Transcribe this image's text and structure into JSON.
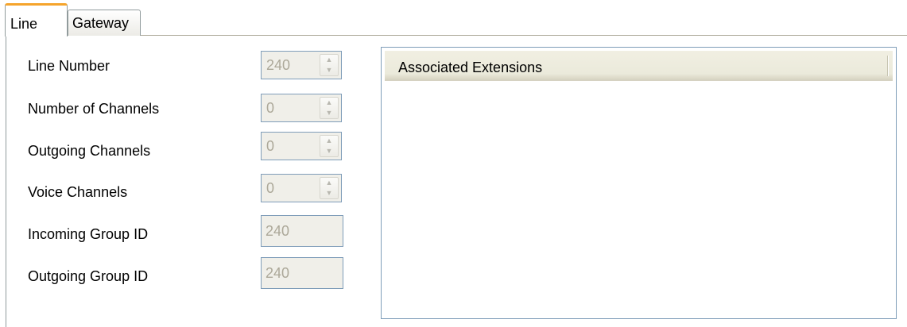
{
  "tabs": [
    {
      "label": "Line",
      "active": true
    },
    {
      "label": "Gateway",
      "active": false
    }
  ],
  "fields": {
    "line_number": {
      "label": "Line Number",
      "value": "240"
    },
    "number_of_channels": {
      "label": "Number of Channels",
      "value": "0"
    },
    "outgoing_channels": {
      "label": "Outgoing Channels",
      "value": "0"
    },
    "voice_channels": {
      "label": "Voice Channels",
      "value": "0"
    },
    "incoming_group_id": {
      "label": "Incoming Group ID",
      "value": "240"
    },
    "outgoing_group_id": {
      "label": "Outgoing Group ID",
      "value": "240"
    }
  },
  "extensions_list": {
    "column_header": "Associated Extensions",
    "items": []
  },
  "icons": {
    "spin_up": "chevron-up-icon",
    "spin_down": "chevron-down-icon"
  },
  "colors": {
    "active_tab_accent": "#f5a42c",
    "border": "#7f9db9",
    "disabled_bg": "#f0efe9",
    "disabled_text": "#aca899"
  }
}
